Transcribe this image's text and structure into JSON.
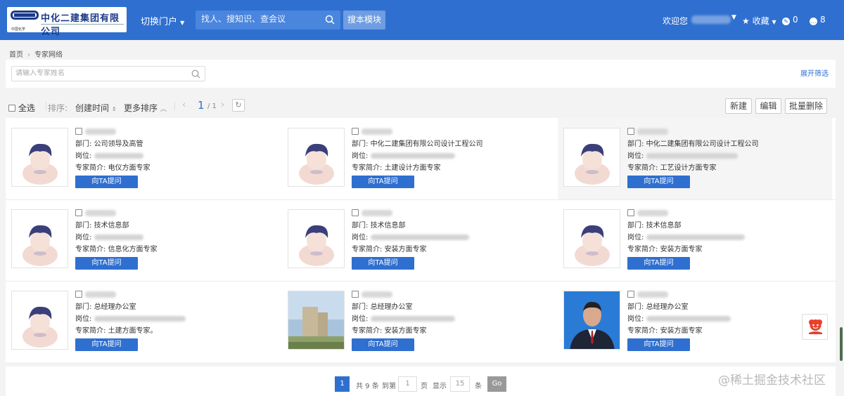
{
  "header": {
    "logo_name": "中化二建集团有限公司",
    "logo_sub": "中国化学",
    "portal_label": "切换门户",
    "search_placeholder": "找人、搜知识、查会议",
    "module_button": "搜本模块",
    "welcome": "欢迎您",
    "favorites": "收藏",
    "badge1_count": "0",
    "badge2_count": "8"
  },
  "breadcrumb": {
    "home": "首页",
    "current": "专家网络"
  },
  "filter": {
    "name_placeholder": "请输入专家姓名",
    "expand_label": "展开筛选"
  },
  "toolbar": {
    "select_all": "全选",
    "sort_label": "排序:",
    "sort_field": "创建时间",
    "more_sort": "更多排序",
    "page_current": "1",
    "page_total": "/ 1",
    "new": "新建",
    "edit": "编辑",
    "batch_delete": "批量删除"
  },
  "labels": {
    "dept": "部门: ",
    "post": "岗位: ",
    "intro": "专家简介: ",
    "ask": "向TA提问"
  },
  "experts": [
    {
      "dept": "公司领导及高管",
      "intro": "电仪方面专家",
      "photo": "avatar"
    },
    {
      "dept": "中化二建集团有限公司设计工程公司",
      "intro": "土建设计方面专家",
      "photo": "avatar"
    },
    {
      "dept": "中化二建集团有限公司设计工程公司",
      "intro": "工艺设计方面专家",
      "photo": "avatar"
    },
    {
      "dept": "技术信息部",
      "intro": "信息化方面专家",
      "photo": "avatar"
    },
    {
      "dept": "技术信息部",
      "intro": "安装方面专家",
      "photo": "avatar"
    },
    {
      "dept": "技术信息部",
      "intro": "安装方面专家",
      "photo": "avatar"
    },
    {
      "dept": "总经理办公室",
      "intro": "土建方面专家。",
      "photo": "avatar"
    },
    {
      "dept": "总经理办公室",
      "intro": "安装方面专家",
      "photo": "building"
    },
    {
      "dept": "总经理办公室",
      "intro": "安装方面专家",
      "photo": "portrait"
    }
  ],
  "pagination": {
    "current": "1",
    "total_text": "共 9 条",
    "goto_label": "到第",
    "goto_value": "1",
    "page_unit": "页",
    "show_label": "显示",
    "show_value": "15",
    "item_unit": "条",
    "go": "Go"
  },
  "watermark": "@稀土掘金技术社区",
  "colors": {
    "primary": "#2f6fd0",
    "header_bg": "#2f6fd0"
  }
}
